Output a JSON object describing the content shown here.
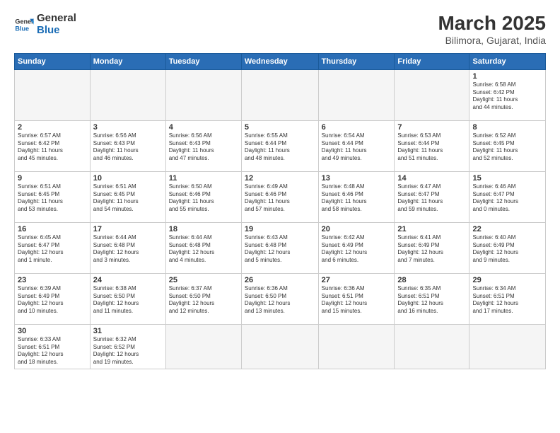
{
  "header": {
    "logo_general": "General",
    "logo_blue": "Blue",
    "title": "March 2025",
    "subtitle": "Bilimora, Gujarat, India"
  },
  "weekdays": [
    "Sunday",
    "Monday",
    "Tuesday",
    "Wednesday",
    "Thursday",
    "Friday",
    "Saturday"
  ],
  "rows": [
    [
      {
        "day": "",
        "info": ""
      },
      {
        "day": "",
        "info": ""
      },
      {
        "day": "",
        "info": ""
      },
      {
        "day": "",
        "info": ""
      },
      {
        "day": "",
        "info": ""
      },
      {
        "day": "",
        "info": ""
      },
      {
        "day": "1",
        "info": "Sunrise: 6:58 AM\nSunset: 6:42 PM\nDaylight: 11 hours\nand 44 minutes."
      }
    ],
    [
      {
        "day": "2",
        "info": "Sunrise: 6:57 AM\nSunset: 6:42 PM\nDaylight: 11 hours\nand 45 minutes."
      },
      {
        "day": "3",
        "info": "Sunrise: 6:56 AM\nSunset: 6:43 PM\nDaylight: 11 hours\nand 46 minutes."
      },
      {
        "day": "4",
        "info": "Sunrise: 6:56 AM\nSunset: 6:43 PM\nDaylight: 11 hours\nand 47 minutes."
      },
      {
        "day": "5",
        "info": "Sunrise: 6:55 AM\nSunset: 6:44 PM\nDaylight: 11 hours\nand 48 minutes."
      },
      {
        "day": "6",
        "info": "Sunrise: 6:54 AM\nSunset: 6:44 PM\nDaylight: 11 hours\nand 49 minutes."
      },
      {
        "day": "7",
        "info": "Sunrise: 6:53 AM\nSunset: 6:44 PM\nDaylight: 11 hours\nand 51 minutes."
      },
      {
        "day": "8",
        "info": "Sunrise: 6:52 AM\nSunset: 6:45 PM\nDaylight: 11 hours\nand 52 minutes."
      }
    ],
    [
      {
        "day": "9",
        "info": "Sunrise: 6:51 AM\nSunset: 6:45 PM\nDaylight: 11 hours\nand 53 minutes."
      },
      {
        "day": "10",
        "info": "Sunrise: 6:51 AM\nSunset: 6:45 PM\nDaylight: 11 hours\nand 54 minutes."
      },
      {
        "day": "11",
        "info": "Sunrise: 6:50 AM\nSunset: 6:46 PM\nDaylight: 11 hours\nand 55 minutes."
      },
      {
        "day": "12",
        "info": "Sunrise: 6:49 AM\nSunset: 6:46 PM\nDaylight: 11 hours\nand 57 minutes."
      },
      {
        "day": "13",
        "info": "Sunrise: 6:48 AM\nSunset: 6:46 PM\nDaylight: 11 hours\nand 58 minutes."
      },
      {
        "day": "14",
        "info": "Sunrise: 6:47 AM\nSunset: 6:47 PM\nDaylight: 11 hours\nand 59 minutes."
      },
      {
        "day": "15",
        "info": "Sunrise: 6:46 AM\nSunset: 6:47 PM\nDaylight: 12 hours\nand 0 minutes."
      }
    ],
    [
      {
        "day": "16",
        "info": "Sunrise: 6:45 AM\nSunset: 6:47 PM\nDaylight: 12 hours\nand 1 minute."
      },
      {
        "day": "17",
        "info": "Sunrise: 6:44 AM\nSunset: 6:48 PM\nDaylight: 12 hours\nand 3 minutes."
      },
      {
        "day": "18",
        "info": "Sunrise: 6:44 AM\nSunset: 6:48 PM\nDaylight: 12 hours\nand 4 minutes."
      },
      {
        "day": "19",
        "info": "Sunrise: 6:43 AM\nSunset: 6:48 PM\nDaylight: 12 hours\nand 5 minutes."
      },
      {
        "day": "20",
        "info": "Sunrise: 6:42 AM\nSunset: 6:49 PM\nDaylight: 12 hours\nand 6 minutes."
      },
      {
        "day": "21",
        "info": "Sunrise: 6:41 AM\nSunset: 6:49 PM\nDaylight: 12 hours\nand 7 minutes."
      },
      {
        "day": "22",
        "info": "Sunrise: 6:40 AM\nSunset: 6:49 PM\nDaylight: 12 hours\nand 9 minutes."
      }
    ],
    [
      {
        "day": "23",
        "info": "Sunrise: 6:39 AM\nSunset: 6:49 PM\nDaylight: 12 hours\nand 10 minutes."
      },
      {
        "day": "24",
        "info": "Sunrise: 6:38 AM\nSunset: 6:50 PM\nDaylight: 12 hours\nand 11 minutes."
      },
      {
        "day": "25",
        "info": "Sunrise: 6:37 AM\nSunset: 6:50 PM\nDaylight: 12 hours\nand 12 minutes."
      },
      {
        "day": "26",
        "info": "Sunrise: 6:36 AM\nSunset: 6:50 PM\nDaylight: 12 hours\nand 13 minutes."
      },
      {
        "day": "27",
        "info": "Sunrise: 6:36 AM\nSunset: 6:51 PM\nDaylight: 12 hours\nand 15 minutes."
      },
      {
        "day": "28",
        "info": "Sunrise: 6:35 AM\nSunset: 6:51 PM\nDaylight: 12 hours\nand 16 minutes."
      },
      {
        "day": "29",
        "info": "Sunrise: 6:34 AM\nSunset: 6:51 PM\nDaylight: 12 hours\nand 17 minutes."
      }
    ],
    [
      {
        "day": "30",
        "info": "Sunrise: 6:33 AM\nSunset: 6:51 PM\nDaylight: 12 hours\nand 18 minutes."
      },
      {
        "day": "31",
        "info": "Sunrise: 6:32 AM\nSunset: 6:52 PM\nDaylight: 12 hours\nand 19 minutes."
      },
      {
        "day": "",
        "info": ""
      },
      {
        "day": "",
        "info": ""
      },
      {
        "day": "",
        "info": ""
      },
      {
        "day": "",
        "info": ""
      },
      {
        "day": "",
        "info": ""
      }
    ]
  ]
}
